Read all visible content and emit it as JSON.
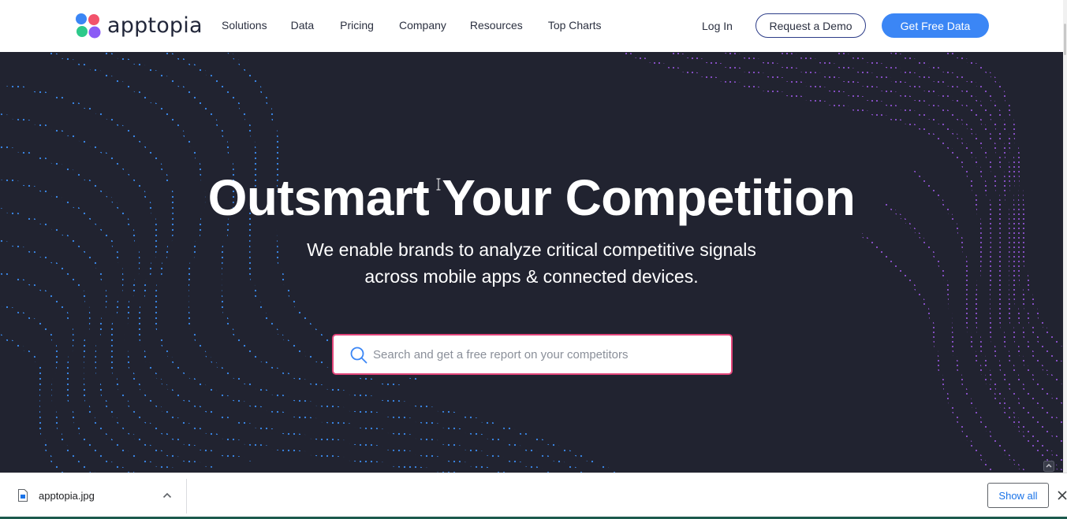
{
  "brand": {
    "name": "apptopia",
    "logo_colors": [
      "#3b86f5",
      "#f2536b",
      "#2dc98a",
      "#8b5cf6"
    ]
  },
  "nav": {
    "items": [
      "Solutions",
      "Data",
      "Pricing",
      "Company",
      "Resources",
      "Top Charts"
    ]
  },
  "header_actions": {
    "login": "Log In",
    "demo": "Request a Demo",
    "free": "Get Free Data"
  },
  "hero": {
    "title": "Outsmart Your Competition",
    "subtitle_line1": "We enable brands to analyze critical competitive signals",
    "subtitle_line2": "across mobile apps & connected devices.",
    "search_placeholder": "Search and get a free report on your competitors",
    "search_icon": "search-icon",
    "colors": {
      "background": "#212330",
      "left_wave": "#3b8df2",
      "right_wave": "#a45cf0",
      "search_border": "#e2457a"
    }
  },
  "download_bar": {
    "file_name": "apptopia.jpg",
    "show_all": "Show all"
  }
}
